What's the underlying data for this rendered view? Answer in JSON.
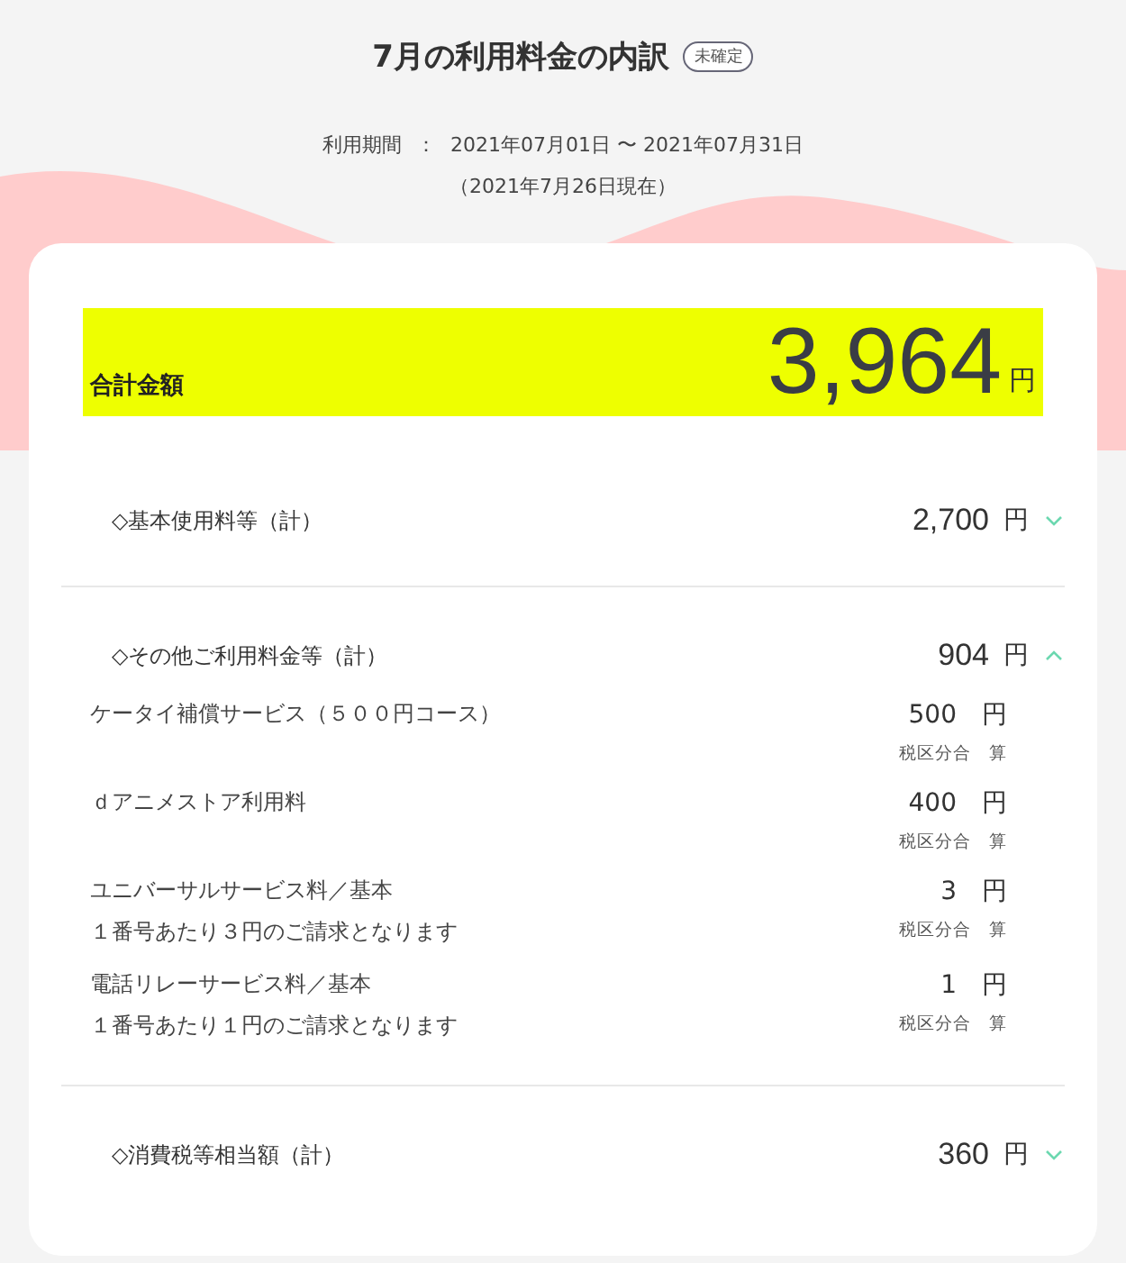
{
  "title": "7月の利用料金の内訳",
  "status_badge": "未確定",
  "period": {
    "label": "利用期間",
    "separator": "：",
    "value": "2021年07月01日 〜 2021年07月31日",
    "as_of": "（2021年7月26日現在）"
  },
  "total": {
    "label": "合計金額",
    "amount": "3,964",
    "unit": "円"
  },
  "sections": [
    {
      "title": "◇基本使用料等（計）",
      "amount": "2,700",
      "unit": "円",
      "expanded": false
    },
    {
      "title": "◇その他ご利用料金等（計）",
      "amount": "904",
      "unit": "円",
      "expanded": true,
      "items": [
        {
          "name": "ケータイ補償サービス（５００円コース）",
          "amount": "500",
          "unit": "円",
          "tax": "税区分合　算"
        },
        {
          "name": "ｄアニメストア利用料",
          "amount": "400",
          "unit": "円",
          "tax": "税区分合　算"
        },
        {
          "name": "ユニバーサルサービス料／基本",
          "note": "１番号あたり３円のご請求となります",
          "amount": "3",
          "unit": "円",
          "tax": "税区分合　算"
        },
        {
          "name": "電話リレーサービス料／基本",
          "note": "１番号あたり１円のご請求となります",
          "amount": "1",
          "unit": "円",
          "tax": "税区分合　算"
        }
      ]
    },
    {
      "title": "◇消費税等相当額（計）",
      "amount": "360",
      "unit": "円",
      "expanded": false
    }
  ]
}
